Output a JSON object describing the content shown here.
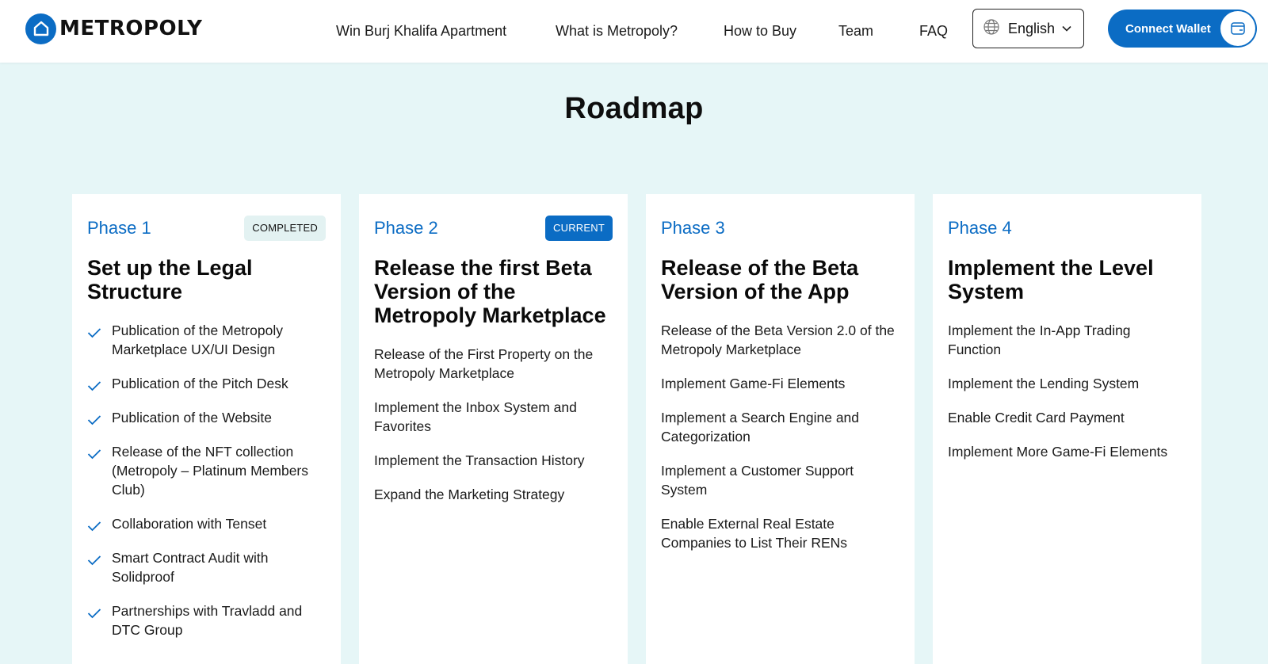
{
  "brand": {
    "name": "METROPOLY"
  },
  "nav": {
    "items": [
      {
        "label": "Win Burj Khalifa Apartment"
      },
      {
        "label": "What is Metropoly?"
      },
      {
        "label": "How to Buy"
      },
      {
        "label": "Team"
      },
      {
        "label": "FAQ"
      }
    ],
    "language": "English",
    "connect_wallet": "Connect Wallet"
  },
  "colors": {
    "accent": "#0b6cc4",
    "background": "#e6f6f7"
  },
  "roadmap": {
    "title": "Roadmap",
    "phases": [
      {
        "label": "Phase 1",
        "badge": "COMPLETED",
        "title": "Set up the Legal Structure",
        "items": [
          "Publication of the Metropoly Marketplace UX/UI Design",
          "Publication of the Pitch Desk",
          "Publication of the Website",
          "Release of the NFT collection (Metropoly – Platinum Members Club)",
          "Collaboration with Tenset",
          "Smart Contract Audit with Solidproof",
          "Partnerships with Travladd and DTC Group"
        ]
      },
      {
        "label": "Phase 2",
        "badge": "CURRENT",
        "title": "Release the first Beta Version of the Metropoly Marketplace",
        "items": [
          "Release of the First Property on the Metropoly Marketplace",
          "Implement the Inbox System and Favorites",
          "Implement the Transaction History",
          "Expand the Marketing Strategy"
        ]
      },
      {
        "label": "Phase 3",
        "badge": "",
        "title": "Release of the Beta Version of the App",
        "items": [
          "Release of the Beta Version 2.0 of the Metropoly Marketplace",
          "Implement Game-Fi Elements",
          "Implement a Search Engine and Categorization",
          "Implement a Customer Support System",
          "Enable External Real Estate Companies to List Their RENs"
        ]
      },
      {
        "label": "Phase 4",
        "badge": "",
        "title": "Implement the Level System",
        "items": [
          "Implement the In-App Trading Function",
          "Implement the Lending System",
          "Enable Credit Card Payment",
          "Implement More Game-Fi Elements"
        ]
      }
    ]
  }
}
